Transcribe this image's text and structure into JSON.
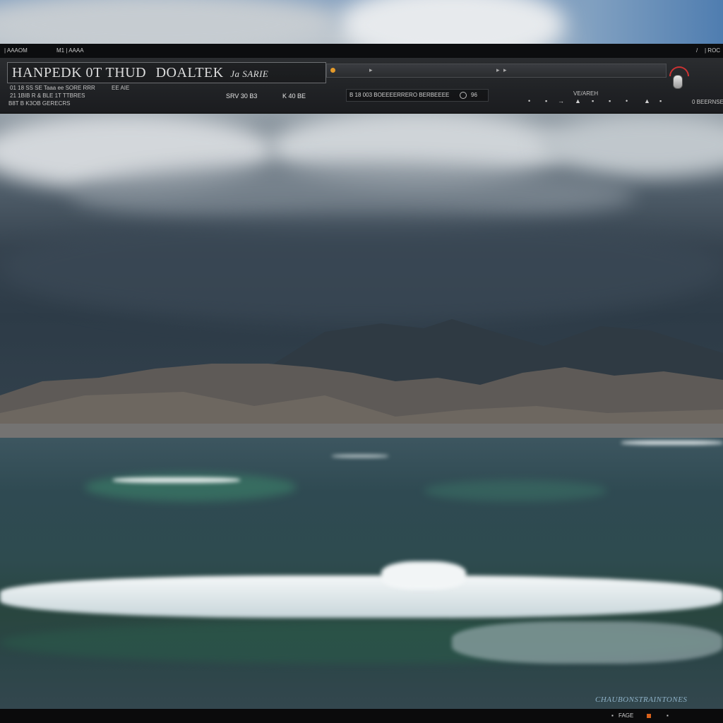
{
  "window": {
    "title": "HANPEDK 0T THUD",
    "title_highlight": "DOALTEK",
    "title_suffix": "Ja SARIE"
  },
  "topstrip": {
    "left_a": "| AAAOM",
    "left_b": "M1 | AAAA",
    "right_a": "/",
    "right_b": "| ROC"
  },
  "header": {
    "row1_left": "01 18 SS  SE\t  Taaa ee SORE RRR",
    "row1_left_b": "EE AIE",
    "row2_left": "21 1BIB  R & BLE 1T    TTBRES",
    "row3_left": "B8T    B  K3OB GERECRS",
    "middle_label": "SRV 30 B3",
    "middle_label_b": "K 40 BE",
    "segment_label": "B 18 003   BOEEEERRERO BERBEEEE",
    "segment_num": "96",
    "right_label": "VE/AREH",
    "right_link": "0 BEERNSE",
    "toolbar": [
      "•",
      "▪",
      "→",
      "▲",
      "▪",
      "▪",
      "•",
      "▲",
      "▪"
    ]
  },
  "footer": {
    "credit": "CHAUBONSTRAINTONES",
    "items": [
      "▪",
      "FAGE",
      "▪"
    ]
  },
  "colors": {
    "accent_orange": "#e49a2a",
    "gauge_red": "#cc3333",
    "credit_blue": "#8fb2c8"
  }
}
